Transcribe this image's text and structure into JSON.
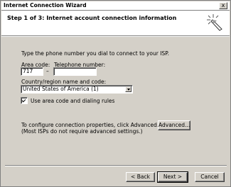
{
  "window": {
    "title": "Internet Connection Wizard",
    "close_glyph": "x"
  },
  "header": {
    "step_title": "Step 1 of 3: Internet account connection information",
    "icon": "wizard-sparkle-icon"
  },
  "body": {
    "instruction": "Type the phone number you dial to connect to your ISP.",
    "area_code_label": "Area code:",
    "area_code_value": "717",
    "dash": "–",
    "telephone_label": "Telephone number:",
    "telephone_value": "",
    "country_label": "Country/region name and code:",
    "country_value": "United States of America (1)",
    "checkbox_label": "Use area code and dialing rules",
    "checkbox_checked": true,
    "advanced_text_line1": "To configure connection properties, click Advanced.",
    "advanced_text_line2": "(Most ISPs do not require advanced settings.)",
    "advanced_button": "Advanced..."
  },
  "footer": {
    "back_button": "< Back",
    "next_button": "Next >",
    "cancel_button": "Cancel"
  }
}
